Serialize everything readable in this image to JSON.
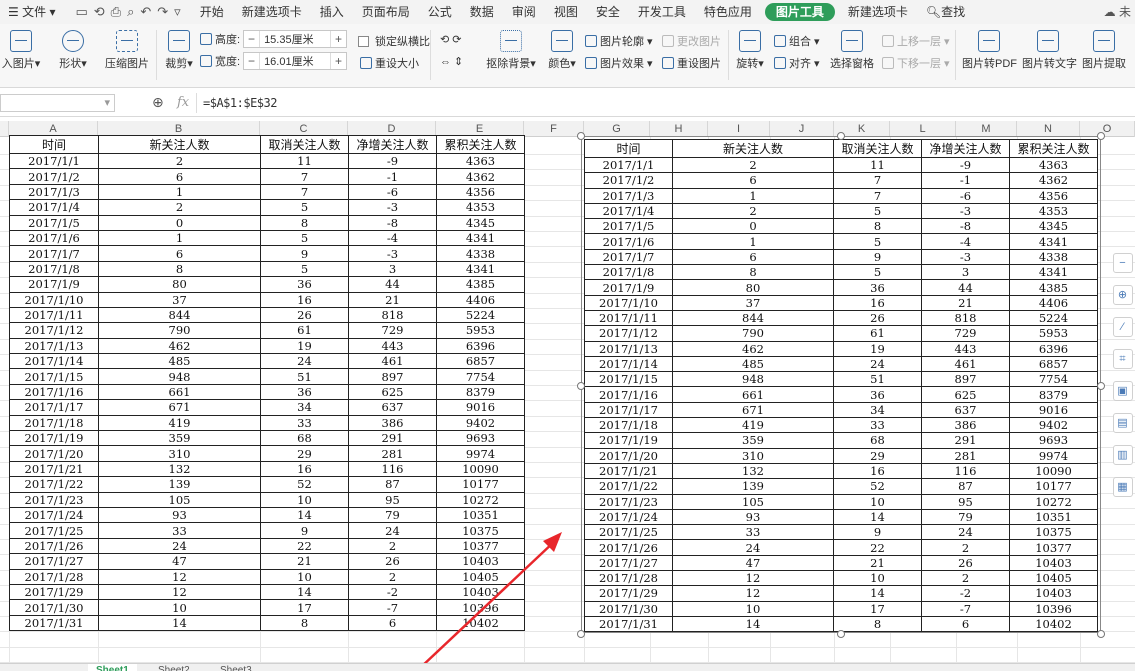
{
  "menu": {
    "file": "文件",
    "tabs": [
      "开始",
      "新建选项卡",
      "插入",
      "页面布局",
      "公式",
      "数据",
      "审阅",
      "视图",
      "安全",
      "开发工具",
      "特色应用",
      "图片工具",
      "新建选项卡"
    ],
    "active_tab": "图片工具",
    "search": "查找",
    "cloud": "未"
  },
  "ribbon": {
    "insert_image": "入图片",
    "shape": "形状",
    "compress": "压缩图片",
    "crop": "裁剪",
    "height_label": "高度:",
    "height_value": "15.35厘米",
    "width_label": "宽度:",
    "width_value": "16.01厘米",
    "lock_ratio": "锁定纵横比",
    "reset_size": "重设大小",
    "remove_bg": "抠除背景",
    "color": "颜色",
    "outline": "图片轮廓",
    "change_image": "更改图片",
    "effects": "图片效果",
    "reset_image": "重设图片",
    "rotate": "旋转",
    "group": "组合",
    "align": "对齐",
    "selection_pane": "选择窗格",
    "up_layer": "上移一层",
    "down_layer": "下移一层",
    "to_pdf": "图片转PDF",
    "to_text": "图片转文字",
    "extract": "图片提取"
  },
  "formula_bar": {
    "fx": "fx",
    "formula": "=$A$1:$E$32"
  },
  "columns_left": [
    "A",
    "B",
    "C",
    "D",
    "E",
    "F"
  ],
  "columns_right": [
    "G",
    "H",
    "I",
    "J",
    "K",
    "L",
    "M",
    "N",
    "O"
  ],
  "table": {
    "headers": [
      "时间",
      "新关注人数",
      "取消关注人数",
      "净增关注人数",
      "累积关注人数"
    ],
    "rows": [
      [
        "2017/1/1",
        "2",
        "11",
        "-9",
        "4363"
      ],
      [
        "2017/1/2",
        "6",
        "7",
        "-1",
        "4362"
      ],
      [
        "2017/1/3",
        "1",
        "7",
        "-6",
        "4356"
      ],
      [
        "2017/1/4",
        "2",
        "5",
        "-3",
        "4353"
      ],
      [
        "2017/1/5",
        "0",
        "8",
        "-8",
        "4345"
      ],
      [
        "2017/1/6",
        "1",
        "5",
        "-4",
        "4341"
      ],
      [
        "2017/1/7",
        "6",
        "9",
        "-3",
        "4338"
      ],
      [
        "2017/1/8",
        "8",
        "5",
        "3",
        "4341"
      ],
      [
        "2017/1/9",
        "80",
        "36",
        "44",
        "4385"
      ],
      [
        "2017/1/10",
        "37",
        "16",
        "21",
        "4406"
      ],
      [
        "2017/1/11",
        "844",
        "26",
        "818",
        "5224"
      ],
      [
        "2017/1/12",
        "790",
        "61",
        "729",
        "5953"
      ],
      [
        "2017/1/13",
        "462",
        "19",
        "443",
        "6396"
      ],
      [
        "2017/1/14",
        "485",
        "24",
        "461",
        "6857"
      ],
      [
        "2017/1/15",
        "948",
        "51",
        "897",
        "7754"
      ],
      [
        "2017/1/16",
        "661",
        "36",
        "625",
        "8379"
      ],
      [
        "2017/1/17",
        "671",
        "34",
        "637",
        "9016"
      ],
      [
        "2017/1/18",
        "419",
        "33",
        "386",
        "9402"
      ],
      [
        "2017/1/19",
        "359",
        "68",
        "291",
        "9693"
      ],
      [
        "2017/1/20",
        "310",
        "29",
        "281",
        "9974"
      ],
      [
        "2017/1/21",
        "132",
        "16",
        "116",
        "10090"
      ],
      [
        "2017/1/22",
        "139",
        "52",
        "87",
        "10177"
      ],
      [
        "2017/1/23",
        "105",
        "10",
        "95",
        "10272"
      ],
      [
        "2017/1/24",
        "93",
        "14",
        "79",
        "10351"
      ],
      [
        "2017/1/25",
        "33",
        "9",
        "24",
        "10375"
      ],
      [
        "2017/1/26",
        "24",
        "22",
        "2",
        "10377"
      ],
      [
        "2017/1/27",
        "47",
        "21",
        "26",
        "10403"
      ],
      [
        "2017/1/28",
        "12",
        "10",
        "2",
        "10405"
      ],
      [
        "2017/1/29",
        "12",
        "14",
        "-2",
        "10403"
      ],
      [
        "2017/1/30",
        "10",
        "17",
        "-7",
        "10396"
      ],
      [
        "2017/1/31",
        "14",
        "8",
        "6",
        "10402"
      ]
    ]
  },
  "sheet_tabs": [
    "Sheet1",
    "Sheet2",
    "Sheet3"
  ],
  "colors": {
    "accent": "#2e9d5a",
    "arrow": "#e8262b"
  }
}
